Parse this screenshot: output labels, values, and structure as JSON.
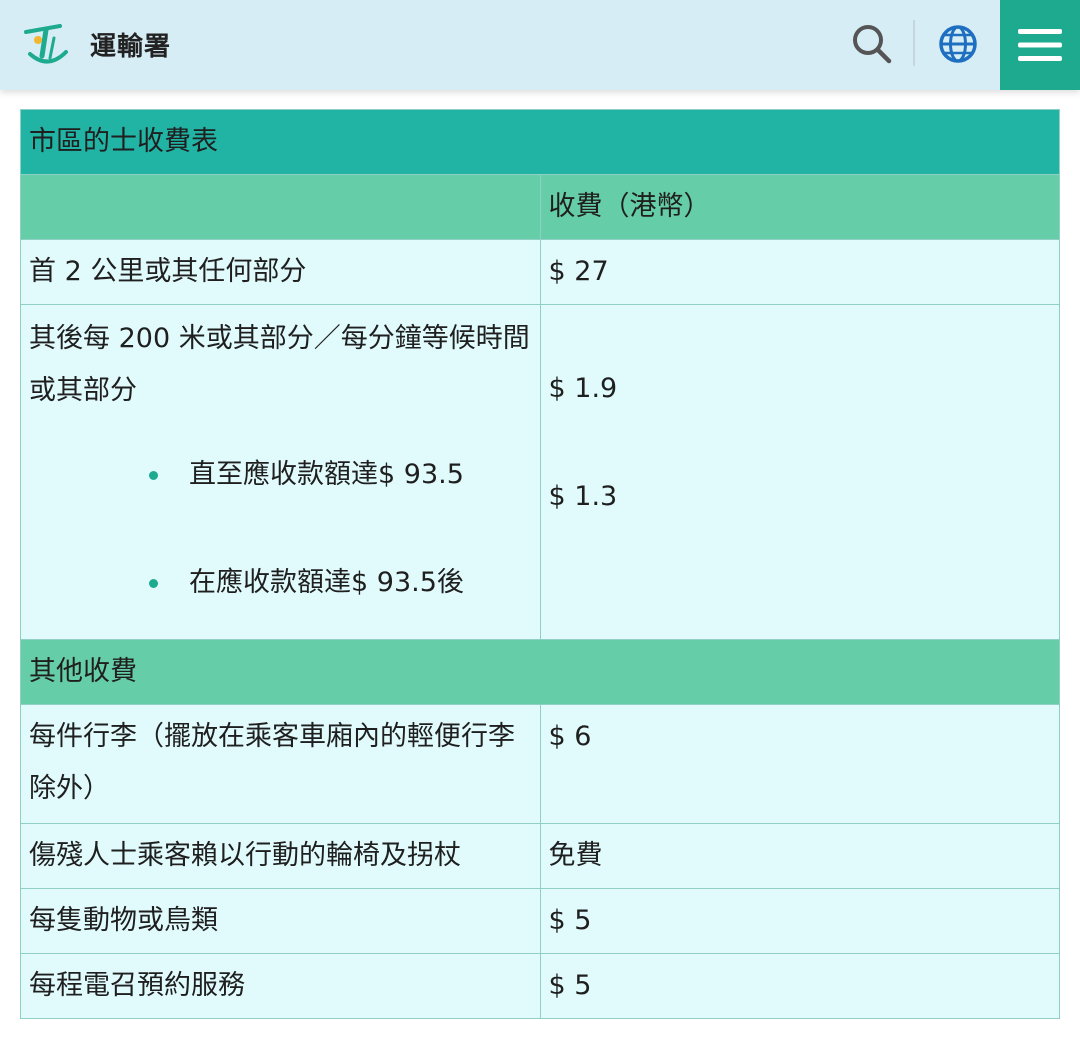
{
  "header": {
    "site_name": "運輸署",
    "logo_icon": "transport-department-logo",
    "search_icon": "search-icon",
    "language_icon": "globe-icon",
    "menu_icon": "hamburger-menu-icon",
    "menu_bg": "#1eaa8e",
    "bg": "#d6edf5"
  },
  "table": {
    "title": "市區的士收費表",
    "col_header_fee": "收費（港幣）",
    "colors": {
      "title_bg": "#21b3a4",
      "subhead_bg": "#66cda9",
      "row_bg": "#e1fbfd",
      "bullet": "#1eaa8e"
    },
    "rows": [
      {
        "label": "首 2 公里或其任何部分",
        "value": "$ 27"
      },
      {
        "label": "其後每 200 米或其部分／每分鐘等候時間或其部分",
        "bullets": [
          {
            "label": "直至應收款額達$ 93.5",
            "value": "$ 1.9"
          },
          {
            "label": "在應收款額達$ 93.5後",
            "value": "$ 1.3"
          }
        ]
      }
    ],
    "other_title": "其他收費",
    "other_rows": [
      {
        "label": "每件行李（擺放在乘客車廂內的輕便行李除外）",
        "value": "$ 6"
      },
      {
        "label": "傷殘人士乘客賴以行動的輪椅及拐杖",
        "value": "免費"
      },
      {
        "label": "每隻動物或鳥類",
        "value": "$ 5"
      },
      {
        "label": "每程電召預約服務",
        "value": "$ 5"
      }
    ]
  }
}
